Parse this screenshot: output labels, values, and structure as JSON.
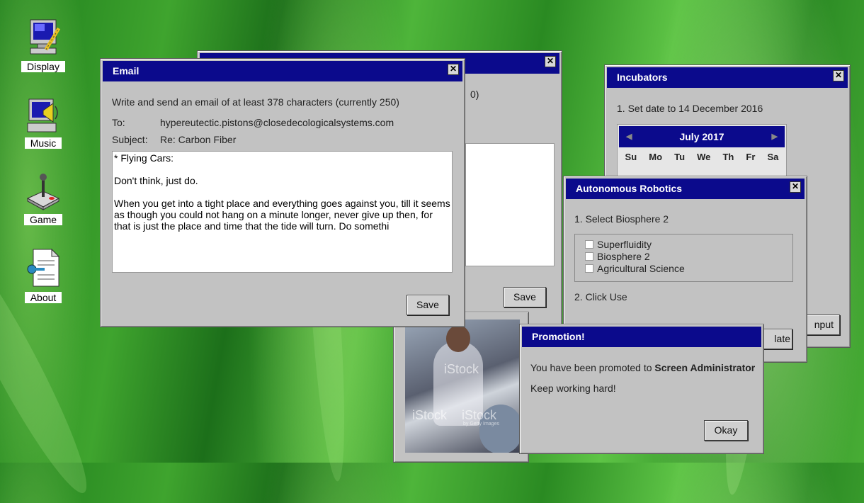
{
  "desktop": {
    "icons": [
      {
        "label": "Display",
        "icon": "display-icon"
      },
      {
        "label": "Music",
        "icon": "music-icon"
      },
      {
        "label": "Game",
        "icon": "joystick-icon"
      },
      {
        "label": "About",
        "icon": "about-document-icon"
      }
    ]
  },
  "email_window": {
    "title": "Email",
    "instruction": "Write and send an email of at least 378 characters (currently 250)",
    "to_label": "To:",
    "to_value": "hypereutectic.pistons@closedecologicalsystems.com",
    "subject_label": "Subject:",
    "subject_value": "Re: Carbon Fiber",
    "body_text": "* Flying Cars:\n\nDon't think, just do.\n\nWhen you get into a tight place and everything goes against you, till it seems as though you could not hang on a minute longer, never give up then, for that is just the place and time that the tide will turn. Do somethi",
    "save_label": "Save"
  },
  "back_email_window": {
    "partial_instruction": "0)",
    "save_label": "Save"
  },
  "incubators_window": {
    "title": "Incubators",
    "instruction": "1. Set date to 14 December 2016",
    "calendar": {
      "month_label": "July 2017",
      "weekdays": [
        "Su",
        "Mo",
        "Tu",
        "We",
        "Th",
        "Fr",
        "Sa"
      ]
    },
    "partial_button": "nput"
  },
  "robotics_window": {
    "title": "Autonomous Robotics",
    "step1": "1. Select Biosphere 2",
    "options": [
      "Superfluidity",
      "Biosphere 2",
      "Agricultural Science"
    ],
    "step2": "2. Click Use",
    "partial_button": "late"
  },
  "promotion_window": {
    "title": "Promotion!",
    "message_prefix": "You have been promoted to ",
    "message_role": "Screen Administrator",
    "message2": "Keep working hard!",
    "okay_label": "Okay"
  },
  "stock_image": {
    "watermark": "iStock",
    "credit": "by Getty Images"
  }
}
